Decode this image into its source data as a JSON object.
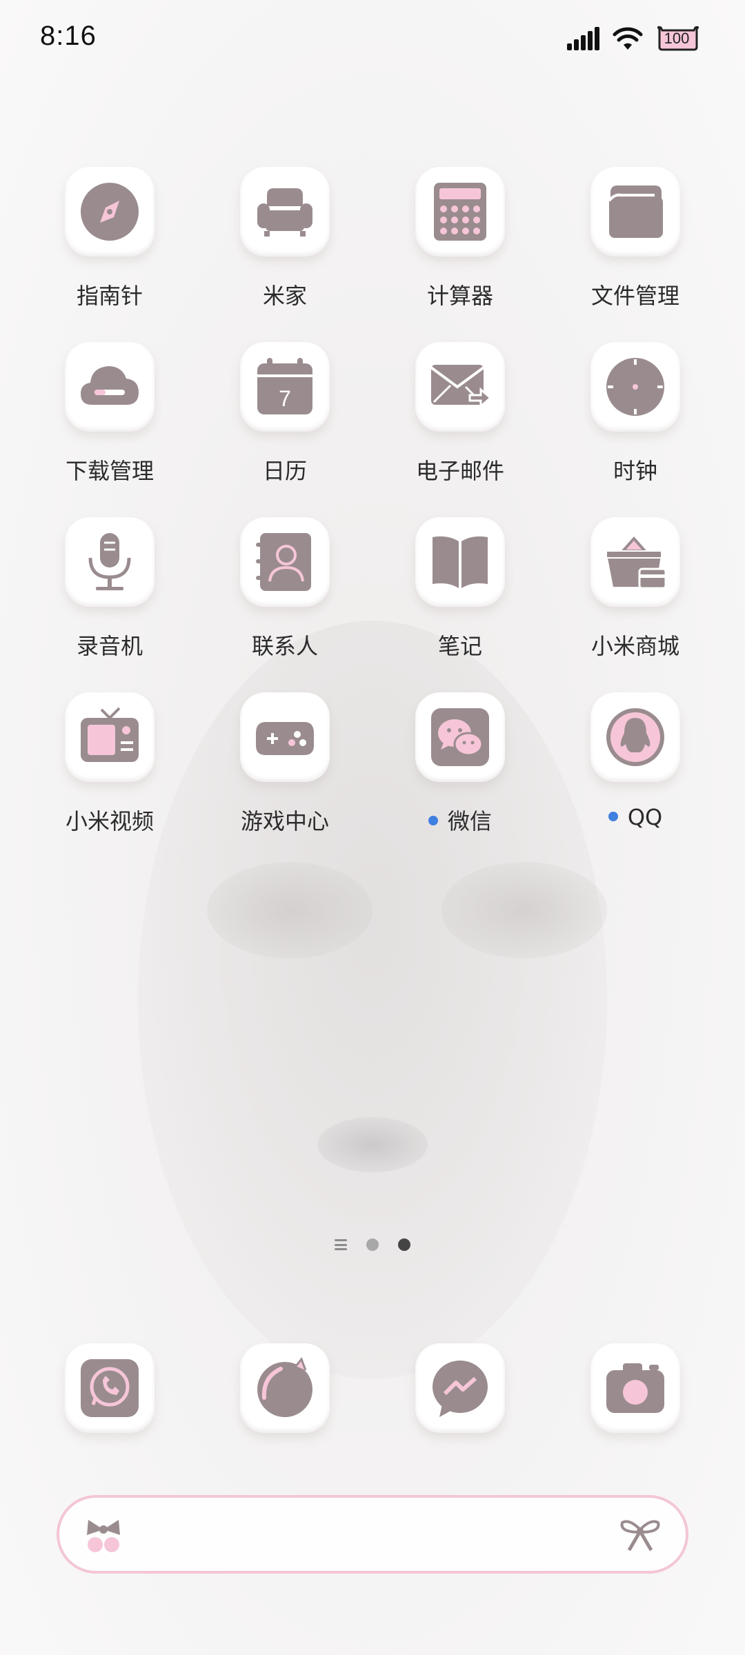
{
  "status_bar": {
    "time": "8:16",
    "battery": "100",
    "icons": [
      "signal-icon",
      "wifi-icon",
      "battery-icon"
    ]
  },
  "theme": {
    "icon_color": "#9a8c8e",
    "accent_pink": "#f6c6d8",
    "notification_dot": "#3f7fe0"
  },
  "apps": [
    {
      "label": "指南针",
      "icon": "compass-icon"
    },
    {
      "label": "米家",
      "icon": "sofa-icon"
    },
    {
      "label": "计算器",
      "icon": "calculator-icon"
    },
    {
      "label": "文件管理",
      "icon": "folder-icon"
    },
    {
      "label": "下载管理",
      "icon": "cloud-download-icon"
    },
    {
      "label": "日历",
      "icon": "calendar-icon",
      "badge_text": "7"
    },
    {
      "label": "电子邮件",
      "icon": "mail-icon"
    },
    {
      "label": "时钟",
      "icon": "clock-icon"
    },
    {
      "label": "录音机",
      "icon": "microphone-icon"
    },
    {
      "label": "联系人",
      "icon": "contacts-icon"
    },
    {
      "label": "笔记",
      "icon": "notes-book-icon"
    },
    {
      "label": "小米商城",
      "icon": "shop-basket-icon"
    },
    {
      "label": "小米视频",
      "icon": "tv-icon"
    },
    {
      "label": "游戏中心",
      "icon": "gamepad-icon"
    },
    {
      "label": "微信",
      "icon": "wechat-icon",
      "notification": true
    },
    {
      "label": "QQ",
      "icon": "qq-penguin-icon",
      "notification": true
    }
  ],
  "pager": {
    "pages": 2,
    "active_page": 2
  },
  "dock": [
    {
      "icon": "phone-icon"
    },
    {
      "icon": "browser-icon"
    },
    {
      "icon": "messenger-icon"
    },
    {
      "icon": "camera-icon"
    }
  ],
  "search_bar": {
    "left_icon": "cherry-bow-icon",
    "right_icon": "ribbon-bow-icon"
  }
}
